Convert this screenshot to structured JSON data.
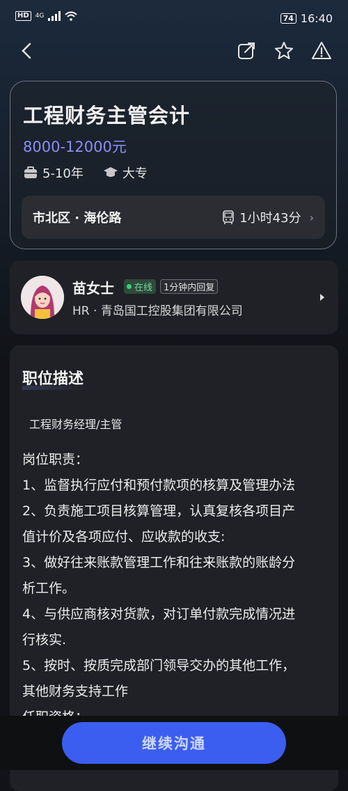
{
  "status_bar": {
    "network": "HD",
    "signal": "4G",
    "battery": "74",
    "time": "16:40"
  },
  "nav": {
    "back_icon": "chevron-left-icon",
    "share_icon": "share-icon",
    "favorite_icon": "star-icon",
    "report_icon": "warning-icon"
  },
  "job": {
    "title": "工程财务主管会计",
    "salary": "8000-12000元",
    "experience": "5-10年",
    "education": "大专",
    "location": "市北区 · 海伦路",
    "commute": "1小时43分"
  },
  "hr": {
    "name": "苗女士",
    "online_label": "在线",
    "reply_label": "1分钟内回复",
    "subtitle": "HR · 青岛国工控股集团有限公司"
  },
  "description": {
    "section_title": "职位描述",
    "position_name": "工程财务经理/主管",
    "lines": [
      "岗位职责：",
      "1、监督执行应付和预付款项的核算及管理办法",
      "2、负责施工项目核算管理，认真复核各项目产",
      "值计价及各项应付、应收款的收支:",
      "3、做好往来账款管理工作和往来账款的账龄分",
      "析工作。",
      "4、与供应商核对货款，对订单付款完成情况进",
      "行核实.",
      "5、按时、按质完成部门领导交办的其他工作，",
      "其他财务支持工作",
      "任职资格："
    ]
  },
  "cta": {
    "label": "继续沟通"
  }
}
